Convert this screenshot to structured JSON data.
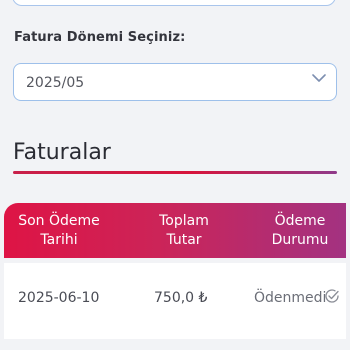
{
  "period": {
    "label": "Fatura Dönemi Seçiniz:",
    "selected": "2025/05"
  },
  "invoices": {
    "title": "Faturalar",
    "columns": [
      {
        "line1": "Son Ödeme",
        "line2": "Tarihi"
      },
      {
        "line1": "Toplam",
        "line2": "Tutar"
      },
      {
        "line1": "Ödeme",
        "line2": "Durumu"
      }
    ],
    "rows": [
      {
        "due_date": "2025-06-10",
        "amount": "750,0 ₺",
        "status": "Ödenmedi",
        "status_icon": "unpaid-check-circle-icon"
      }
    ]
  },
  "colors": {
    "accent_start": "#de1445",
    "accent_end": "#a33281",
    "select_border": "#9ec0ea"
  }
}
